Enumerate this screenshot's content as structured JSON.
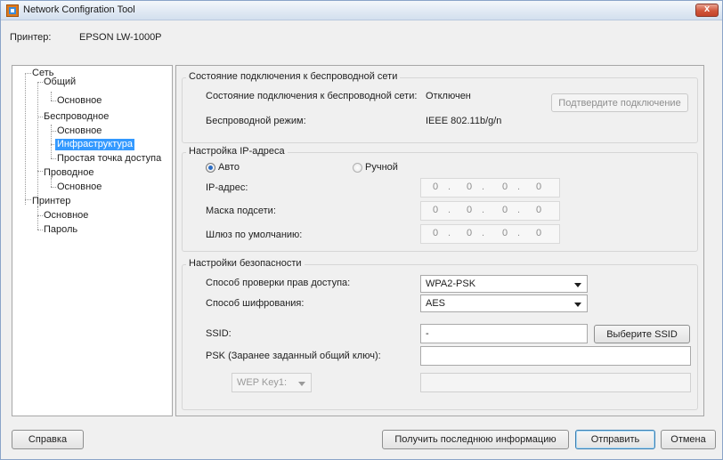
{
  "window": {
    "title": "Network Configration Tool",
    "close_glyph": "x"
  },
  "printer": {
    "label": "Принтер:",
    "value": "EPSON LW-1000P"
  },
  "tree": {
    "items": [
      {
        "label": "Сеть"
      },
      {
        "label": "Общий"
      },
      {
        "label": "Основное"
      },
      {
        "label": "Беспроводное"
      },
      {
        "label": "Основное"
      },
      {
        "label": "Инфраструктура"
      },
      {
        "label": "Простая точка доступа"
      },
      {
        "label": "Проводное"
      },
      {
        "label": "Основное"
      },
      {
        "label": "Принтер"
      },
      {
        "label": "Основное"
      },
      {
        "label": "Пароль"
      }
    ],
    "selected_index": 5
  },
  "wireless_status": {
    "title": "Состояние подключения к беспроводной сети",
    "status_label": "Состояние подключения к беспроводной сети:",
    "status_value": "Отключен",
    "confirm_button": "Подтвердите подключение",
    "mode_label": "Беспроводной режим:",
    "mode_value": "IEEE 802.11b/g/n"
  },
  "ip_settings": {
    "title": "Настройка IP-адреса",
    "auto_label": "Авто",
    "manual_label": "Ручной",
    "auto_selected": true,
    "ip_label": "IP-адрес:",
    "mask_label": "Маска подсети:",
    "gateway_label": "Шлюз по умолчанию:",
    "ip": [
      "0",
      "0",
      "0",
      "0"
    ],
    "mask": [
      "0",
      "0",
      "0",
      "0"
    ],
    "gateway": [
      "0",
      "0",
      "0",
      "0"
    ],
    "separator": "."
  },
  "security": {
    "title": "Настройки безопасности",
    "auth_label": "Способ проверки прав доступа:",
    "auth_value": "WPA2-PSK",
    "enc_label": "Способ шифрования:",
    "enc_value": "AES",
    "ssid_label": "SSID:",
    "ssid_value": "-",
    "select_ssid_button": "Выберите SSID",
    "psk_label": "PSK (Заранее заданный общий ключ):",
    "psk_value": "",
    "wep_key_value": "WEP Key1:",
    "wep_value": ""
  },
  "footer": {
    "help_button": "Справка",
    "refresh_button": "Получить последнюю информацию",
    "send_button": "Отправить",
    "cancel_button": "Отмена"
  }
}
